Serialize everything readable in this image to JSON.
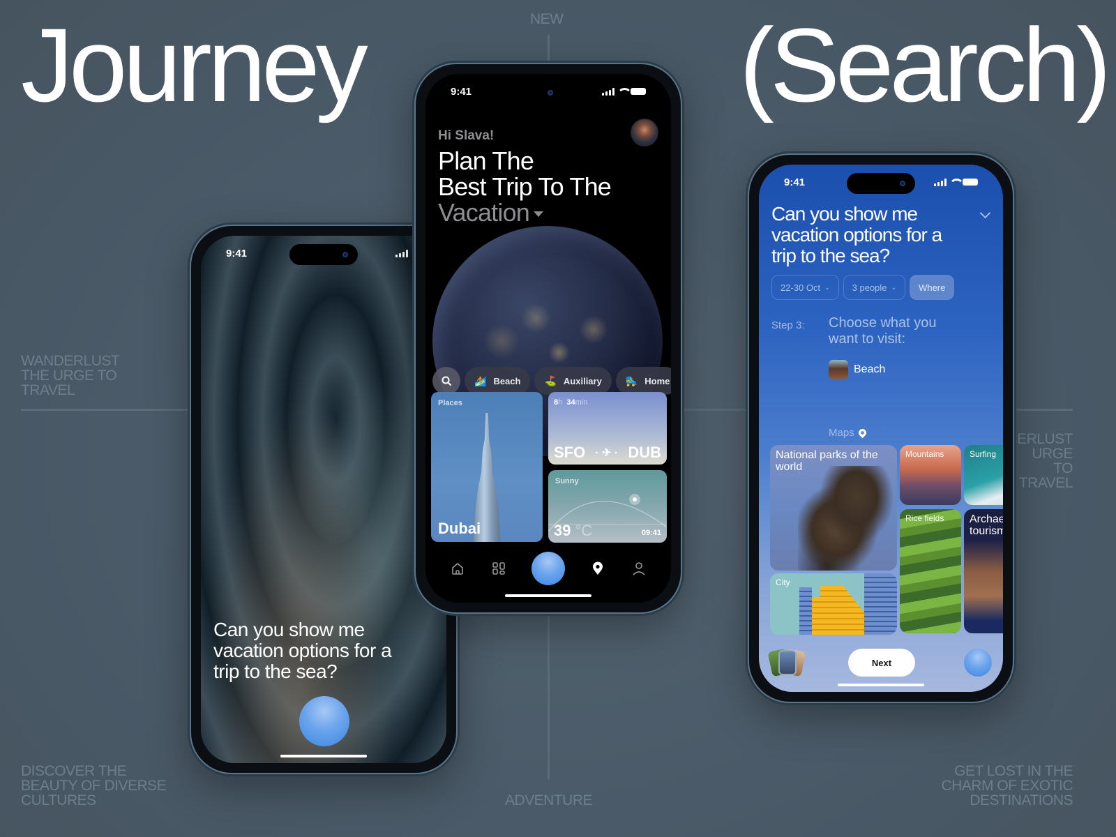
{
  "headline": {
    "left": "Journey",
    "right": "(Search)"
  },
  "captions": {
    "top_center": "NEW",
    "bottom_center": "ADVENTURE",
    "mid_left": [
      "WANDERLUST",
      "THE URGE TO",
      "TRAVEL"
    ],
    "mid_right": [
      "ERLUST",
      "URGE TO",
      "TRAVEL"
    ],
    "bottom_left": [
      "DISCOVER THE",
      "BEAUTY OF DIVERSE",
      "CULTURES"
    ],
    "bottom_right": [
      "GET LOST IN THE",
      "CHARM OF EXOTIC",
      "DESTINATIONS"
    ]
  },
  "phone_left": {
    "status_time": "9:41",
    "question": [
      "Can you show me",
      "vacation options for a",
      "trip to the sea?"
    ],
    "voice_orb": "assistant-orb"
  },
  "phone_center": {
    "status_time": "9:41",
    "greeting": "Hi Slava!",
    "title_lines": [
      "Plan The",
      "Best Trip To The"
    ],
    "title_selectable": "Vacation",
    "chips": [
      {
        "icon": "🏄",
        "label": "Beach"
      },
      {
        "icon": "⛳",
        "label": "Auxiliary"
      },
      {
        "icon": "🛼",
        "label": "Home"
      }
    ],
    "places_card": {
      "label": "Places",
      "city": "Dubai"
    },
    "flight_card": {
      "hours": "8",
      "h_unit": "h",
      "minutes": "34",
      "min_unit": "min",
      "from": "SFO",
      "to": "DUB"
    },
    "weather_card": {
      "condition": "Sunny",
      "temp": "39",
      "unit": "°C",
      "time": "09:41"
    },
    "tabs": [
      "home",
      "apps",
      "assistant",
      "map",
      "profile"
    ],
    "active_tab": "map"
  },
  "phone_right": {
    "status_time": "9:41",
    "question": [
      "Can you show me",
      "vacation options for a",
      "trip to the sea?"
    ],
    "filters": [
      {
        "label": "22-30 Oct",
        "dropdown": true,
        "active": false
      },
      {
        "label": "3 people",
        "dropdown": true,
        "active": false
      },
      {
        "label": "Where",
        "dropdown": false,
        "active": true
      }
    ],
    "step_label": "Step 3:",
    "step_question": [
      "Choose what you",
      "want to visit:"
    ],
    "selected": "Beach",
    "maps_label": "Maps",
    "tiles": [
      {
        "label": "National parks of the world"
      },
      {
        "label": "Mountains"
      },
      {
        "label": "Surfing"
      },
      {
        "label": "Rice fields"
      },
      {
        "label": "Archaeological tourism"
      },
      {
        "label": "City"
      }
    ],
    "next_label": "Next"
  }
}
